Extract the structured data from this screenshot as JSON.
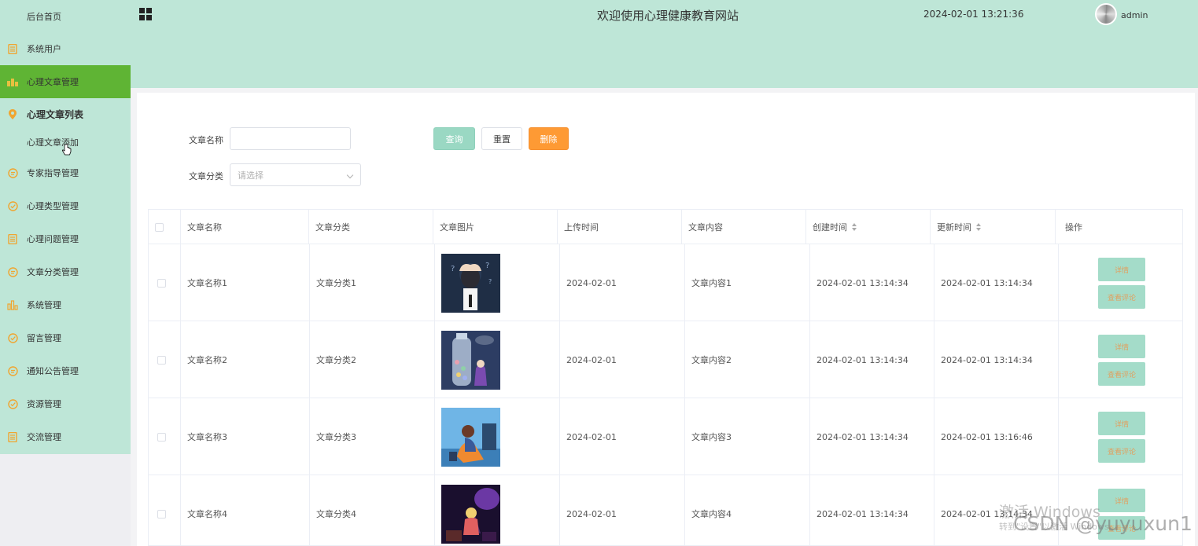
{
  "header": {
    "title": "欢迎使用心理健康教育网站",
    "clock": "2024-02-01 13:21:36",
    "username": "admin"
  },
  "sidebar": {
    "items": [
      {
        "label": "后台首页",
        "icon": "none"
      },
      {
        "label": "系统用户",
        "icon": "document-icon"
      },
      {
        "label": "心理文章管理",
        "icon": "chart-icon",
        "active": true
      },
      {
        "label": "心理文章列表",
        "icon": "location-pin-icon"
      },
      {
        "label": "心理文章添加",
        "icon": "none"
      },
      {
        "label": "专家指导管理",
        "icon": "chat-icon"
      },
      {
        "label": "心理类型管理",
        "icon": "check-circle-icon"
      },
      {
        "label": "心理问题管理",
        "icon": "document-icon"
      },
      {
        "label": "文章分类管理",
        "icon": "chat-icon"
      },
      {
        "label": "系统管理",
        "icon": "bar-chart-icon"
      },
      {
        "label": "留言管理",
        "icon": "check-circle-icon"
      },
      {
        "label": "通知公告管理",
        "icon": "chat-icon"
      },
      {
        "label": "资源管理",
        "icon": "check-circle-icon"
      },
      {
        "label": "交流管理",
        "icon": "document-icon"
      }
    ]
  },
  "filters": {
    "name_label": "文章名称",
    "name_value": "",
    "category_label": "文章分类",
    "category_placeholder": "请选择",
    "query_button": "查询",
    "reset_button": "重置",
    "delete_button": "删除"
  },
  "table": {
    "columns": [
      "文章名称",
      "文章分类",
      "文章图片",
      "上传时间",
      "文章内容",
      "创建时间",
      "更新时间",
      "操作"
    ],
    "rows": [
      {
        "name": "文章名称1",
        "category": "文章分类1",
        "upload": "2024-02-01",
        "content": "文章内容1",
        "created": "2024-02-01 13:14:34",
        "updated": "2024-02-01 13:14:34"
      },
      {
        "name": "文章名称2",
        "category": "文章分类2",
        "upload": "2024-02-01",
        "content": "文章内容2",
        "created": "2024-02-01 13:14:34",
        "updated": "2024-02-01 13:14:34"
      },
      {
        "name": "文章名称3",
        "category": "文章分类3",
        "upload": "2024-02-01",
        "content": "文章内容3",
        "created": "2024-02-01 13:14:34",
        "updated": "2024-02-01 13:16:46"
      },
      {
        "name": "文章名称4",
        "category": "文章分类4",
        "upload": "2024-02-01",
        "content": "文章内容4",
        "created": "2024-02-01 13:14:34",
        "updated": "2024-02-01 13:14:34"
      }
    ],
    "detail_button": "详情",
    "comments_button": "查看评论"
  },
  "overlay": {
    "activate_title": "激活 Windows",
    "activate_sub": "转到\"设置\"以激活 Windows。",
    "csdn": "CSDN @yuyuxun1"
  },
  "colors": {
    "theme": "#bee6d7",
    "active_menu": "#5fb434",
    "delete": "#fe9a34",
    "query": "#9ad8c3"
  }
}
